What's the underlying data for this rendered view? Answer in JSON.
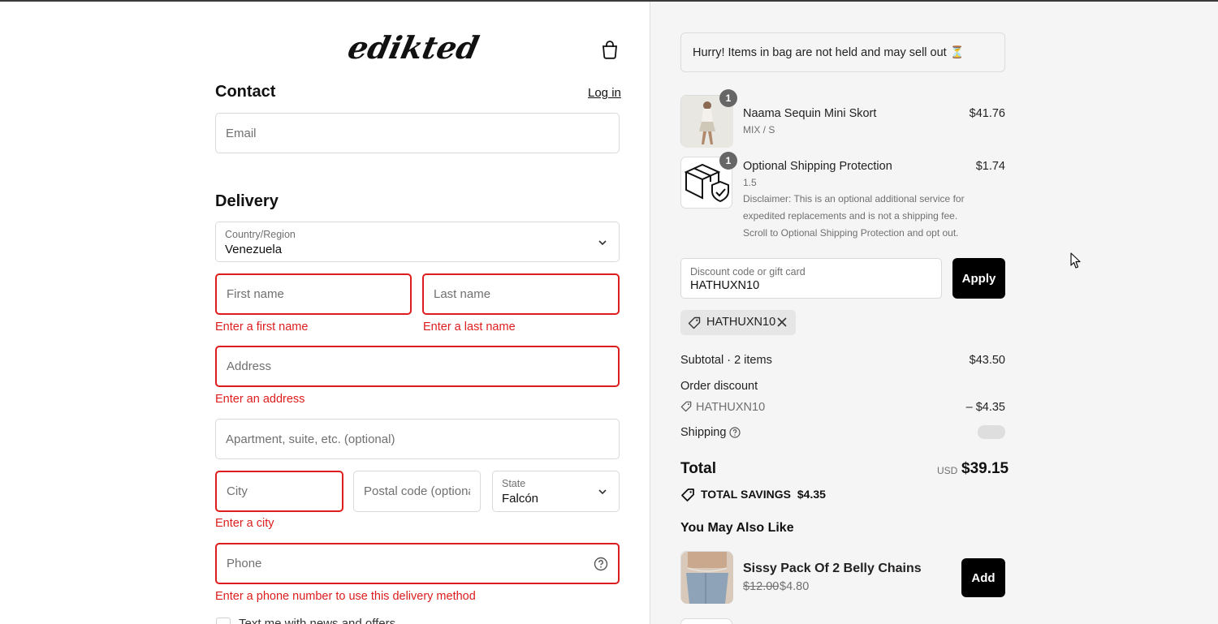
{
  "brand": {
    "logo_text": "edikted"
  },
  "contact": {
    "heading": "Contact",
    "login_label": "Log in",
    "email_placeholder": "Email"
  },
  "delivery": {
    "heading": "Delivery",
    "country_label": "Country/Region",
    "country_value": "Venezuela",
    "first_name_placeholder": "First name",
    "first_name_error": "Enter a first name",
    "last_name_placeholder": "Last name",
    "last_name_error": "Enter a last name",
    "address_placeholder": "Address",
    "address_error": "Enter an address",
    "apartment_placeholder": "Apartment, suite, etc. (optional)",
    "city_placeholder": "City",
    "city_error": "Enter a city",
    "postal_placeholder": "Postal code (optional)",
    "state_label": "State",
    "state_value": "Falcón",
    "phone_placeholder": "Phone",
    "phone_error": "Enter a phone number to use this delivery method",
    "text_offers_label": "Text me with news and offers"
  },
  "summary": {
    "banner": "Hurry! Items in bag are not held and may sell out ⏳",
    "items": [
      {
        "quantity": "1",
        "name": "Naama Sequin Mini Skort",
        "variant": "MIX / S",
        "price": "$41.76"
      },
      {
        "quantity": "1",
        "name": "Optional Shipping Protection",
        "variant": "1.5",
        "price": "$1.74",
        "note": "Disclaimer: This is an optional additional service for expedited replacements and is not a shipping fee. Scroll to Optional Shipping Protection and opt out."
      }
    ],
    "discount_label": "Discount code or gift card",
    "discount_value": "HATHUXN10",
    "apply_label": "Apply",
    "applied_code": "HATHUXN10",
    "subtotal_label": "Subtotal · 2 items",
    "subtotal_value": "$43.50",
    "order_discount_label": "Order discount",
    "order_discount_code": "HATHUXN10",
    "order_discount_value": "– $4.35",
    "shipping_label": "Shipping",
    "total_label": "Total",
    "currency": "USD",
    "total_value": "$39.15",
    "savings_label": "TOTAL SAVINGS",
    "savings_value": "$4.35"
  },
  "recommendations": {
    "heading": "You May Also Like",
    "items": [
      {
        "name": "Sissy Pack Of 2 Belly Chains",
        "old_price": "$12.00",
        "new_price": "$4.80",
        "add_label": "Add"
      }
    ]
  },
  "colors": {
    "error": "#dd1d1d",
    "button": "#000000",
    "summary_bg": "#f5f5f5"
  }
}
